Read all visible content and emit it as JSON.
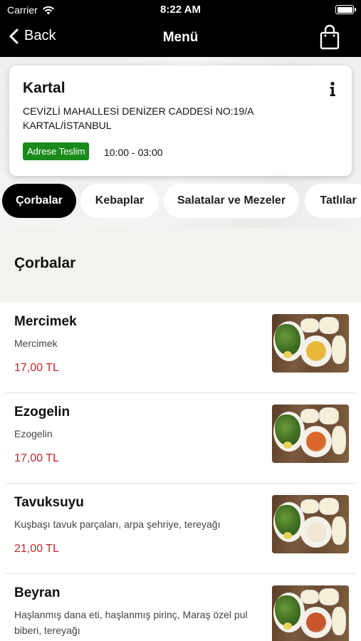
{
  "status_bar": {
    "carrier": "Carrier",
    "time": "8:22 AM"
  },
  "nav": {
    "back_label": "Back",
    "title": "Menü"
  },
  "store": {
    "name": "Kartal",
    "address": "CEVİZLİ MAHALLESİ DENİZER CADDESİ NO:19/A KARTAL/İSTANBUL",
    "delivery_badge": "Adrese Teslim",
    "hours": "10:00 - 03:00"
  },
  "categories": [
    {
      "label": "Çorbalar",
      "active": true
    },
    {
      "label": "Kebaplar",
      "active": false
    },
    {
      "label": "Salatalar ve Mezeler",
      "active": false
    },
    {
      "label": "Tatlılar",
      "active": false
    }
  ],
  "section": {
    "title": "Çorbalar"
  },
  "items": [
    {
      "name": "Mercimek",
      "description": "Mercimek",
      "price": "17,00 TL",
      "soup_color": "#e9b73a"
    },
    {
      "name": "Ezogelin",
      "description": "Ezogelin",
      "price": "17,00 TL",
      "soup_color": "#d9662a"
    },
    {
      "name": "Tavuksuyu",
      "description": "Kuşbaşı tavuk parçaları, arpa şehriye, tereyağı",
      "price": "21,00 TL",
      "soup_color": "#f1e7d4"
    },
    {
      "name": "Beyran",
      "description": "Haşlanmış dana eti, haşlanmış pirinç, Maraş özel pul biberi, tereyağı",
      "price": "",
      "soup_color": "#c8552b"
    }
  ],
  "colors": {
    "accent_price": "#c8262c",
    "badge_green": "#1a8a1a"
  }
}
